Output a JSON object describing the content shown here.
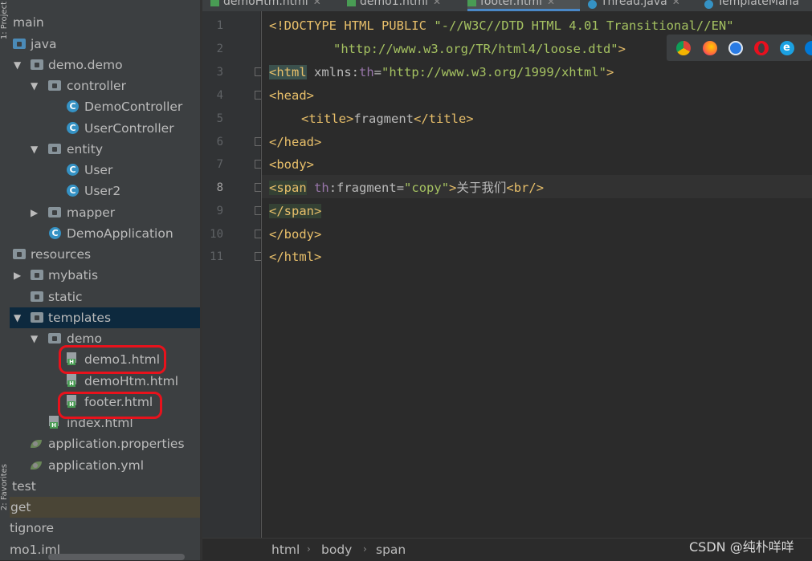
{
  "toolstrip": {
    "top_label": "1: Project",
    "bottom_label": "2: Favorites"
  },
  "tabs": [
    {
      "label": "demoHtm.html",
      "kind": "html",
      "active": false
    },
    {
      "label": "demo1.html",
      "kind": "html",
      "active": false
    },
    {
      "label": "footer.html",
      "kind": "html",
      "active": true
    },
    {
      "label": "Thread.java",
      "kind": "java",
      "active": false
    },
    {
      "label": "TemplateMana",
      "kind": "java",
      "active": false
    }
  ],
  "tree": {
    "main": "main",
    "java": "java",
    "demo_demo": "demo.demo",
    "controller": "controller",
    "demo_controller": "DemoController",
    "user_controller": "UserController",
    "entity": "entity",
    "user": "User",
    "user2": "User2",
    "mapper": "mapper",
    "demo_application": "DemoApplication",
    "resources": "resources",
    "mybatis": "mybatis",
    "static": "static",
    "templates": "templates",
    "demo": "demo",
    "demo1_html": "demo1.html",
    "demoHtm_html": "demoHtm.html",
    "footer_html": "footer.html",
    "index_html": "index.html",
    "application_properties": "application.properties",
    "application_yml": "application.yml",
    "test": "test",
    "get": "get",
    "gitignore": "tignore",
    "iml": "mo1.iml"
  },
  "editor": {
    "line_numbers": [
      "1",
      "2",
      "3",
      "4",
      "5",
      "6",
      "7",
      "8",
      "9",
      "10",
      "11"
    ],
    "current_line": "8",
    "line1": {
      "open": "<!DOCTYPE HTML PUBLIC ",
      "value": "\"-//W3C//DTD HTML 4.01 Transitional//EN\""
    },
    "line2": {
      "value": "\"http://www.w3.org/TR/html4/loose.dtd\"",
      "close": ">"
    },
    "line3": {
      "tag": "<html",
      "attr_name": " xmlns:",
      "attr_ns": "th",
      "eq": "=",
      "attr_value": "\"http://www.w3.org/1999/xhtml\"",
      "close": ">"
    },
    "line4": {
      "text": "<head>"
    },
    "line5": {
      "open": "<title>",
      "text": "fragment",
      "close": "</title>"
    },
    "line6": {
      "text": "</head>"
    },
    "line7": {
      "text": "<body>"
    },
    "line8": {
      "tag": "<span",
      "ns": "th",
      "attr": ":fragment",
      "eq": "=",
      "value": "\"copy\"",
      "close": ">",
      "text": "关于我们",
      "br": "<br/>"
    },
    "line9": {
      "text": "</span>"
    },
    "line10": {
      "text": "</body>"
    },
    "line11": {
      "text": "</html>"
    }
  },
  "browsers": [
    "chrome-icon",
    "firefox-icon",
    "safari-icon",
    "opera-icon",
    "ie-icon",
    "edge-icon"
  ],
  "breadcrumb": [
    "html",
    "body",
    "span"
  ],
  "watermark": "CSDN @纯朴咩咩",
  "colors": {
    "tag": "#e8bf6a",
    "string": "#a5c261",
    "namespace": "#9876aa",
    "selection": "#0d293e",
    "annotation_red": "#e8121c"
  }
}
